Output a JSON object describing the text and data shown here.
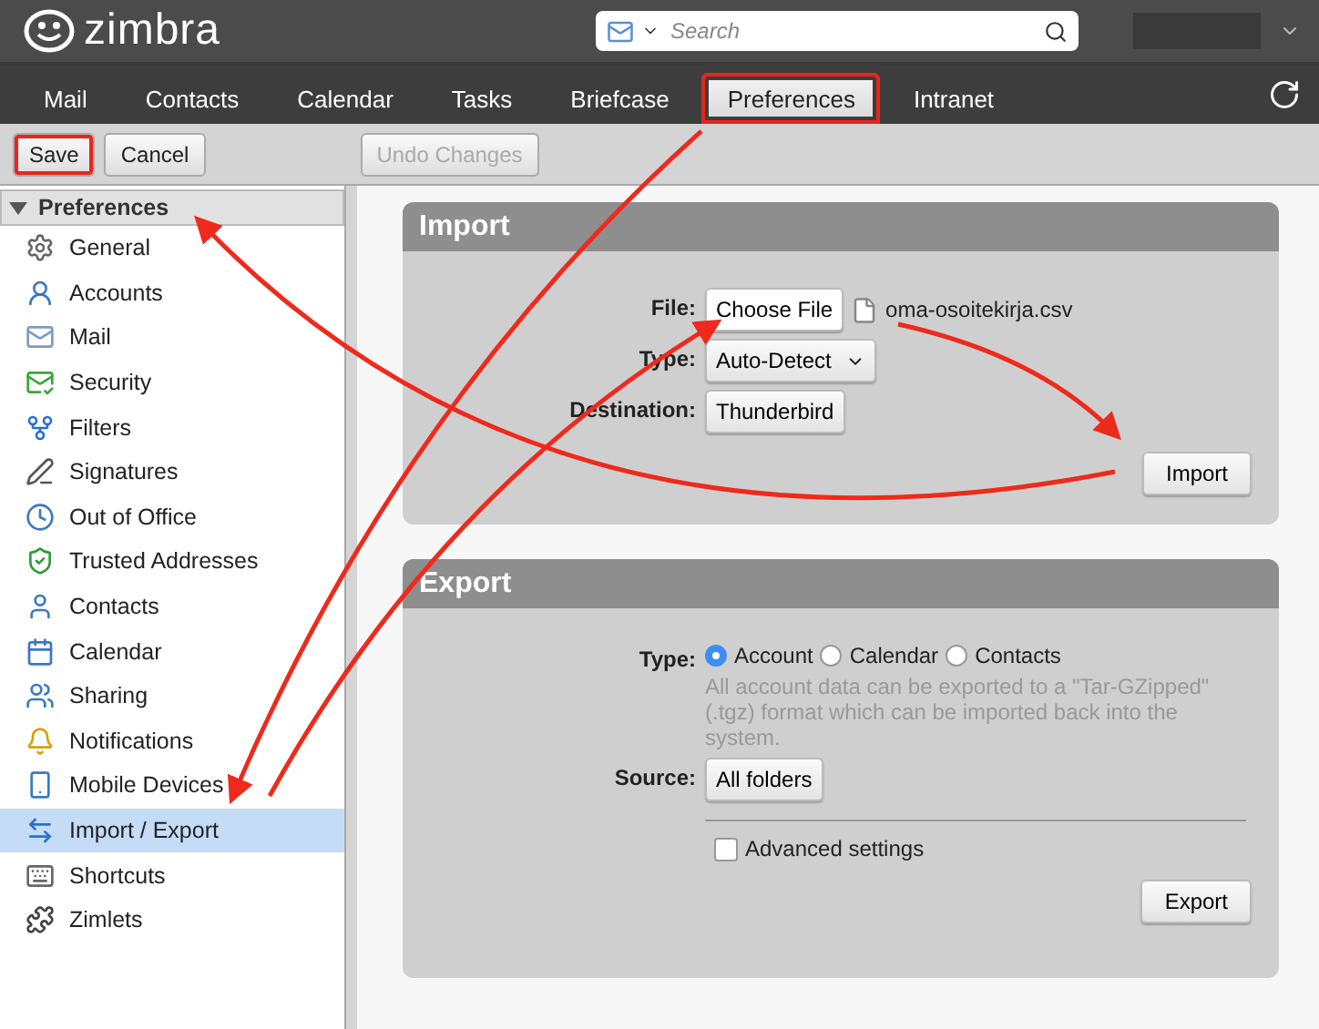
{
  "app": {
    "logo": "zimbra",
    "search": {
      "placeholder": "Search"
    }
  },
  "tabs": [
    {
      "label": "Mail",
      "selected": false,
      "highlighted": false
    },
    {
      "label": "Contacts",
      "selected": false,
      "highlighted": false
    },
    {
      "label": "Calendar",
      "selected": false,
      "highlighted": false
    },
    {
      "label": "Tasks",
      "selected": false,
      "highlighted": false
    },
    {
      "label": "Briefcase",
      "selected": false,
      "highlighted": false
    },
    {
      "label": "Preferences",
      "selected": true,
      "highlighted": true
    },
    {
      "label": "Intranet",
      "selected": false,
      "highlighted": false
    }
  ],
  "toolbar": {
    "buttons": [
      {
        "label": "Save",
        "disabled": false,
        "highlighted": true
      },
      {
        "label": "Cancel",
        "disabled": false,
        "highlighted": false
      },
      {
        "label": "Undo Changes",
        "disabled": true,
        "highlighted": false
      }
    ]
  },
  "sidebar": {
    "title": "Preferences",
    "expanded": true,
    "items": [
      {
        "label": "General",
        "selected": false
      },
      {
        "label": "Accounts",
        "selected": false
      },
      {
        "label": "Mail",
        "selected": false
      },
      {
        "label": "Security",
        "selected": false
      },
      {
        "label": "Filters",
        "selected": false
      },
      {
        "label": "Signatures",
        "selected": false
      },
      {
        "label": "Out of Office",
        "selected": false
      },
      {
        "label": "Trusted Addresses",
        "selected": false
      },
      {
        "label": "Contacts",
        "selected": false
      },
      {
        "label": "Calendar",
        "selected": false
      },
      {
        "label": "Sharing",
        "selected": false
      },
      {
        "label": "Notifications",
        "selected": false
      },
      {
        "label": "Mobile Devices",
        "selected": false
      },
      {
        "label": "Import / Export",
        "selected": true
      },
      {
        "label": "Shortcuts",
        "selected": false
      },
      {
        "label": "Zimlets",
        "selected": false
      }
    ]
  },
  "import": {
    "title": "Import",
    "file_label": "File:",
    "choose_button": "Choose File",
    "file_name": "oma-osoitekirja.csv",
    "type_label": "Type:",
    "type_value": "Auto-Detect",
    "destination_label": "Destination:",
    "destination_value": "Thunderbird",
    "button": "Import"
  },
  "export": {
    "title": "Export",
    "type_label": "Type:",
    "types": [
      {
        "label": "Account",
        "selected": true
      },
      {
        "label": "Calendar",
        "selected": false
      },
      {
        "label": "Contacts",
        "selected": false
      }
    ],
    "hint": "All account data can be exported to a \"Tar-GZipped\" (.tgz) format which can be imported back into the system.",
    "source_label": "Source:",
    "source_value": "All folders",
    "advanced": {
      "label": "Advanced settings",
      "checked": false
    },
    "button": "Export"
  }
}
